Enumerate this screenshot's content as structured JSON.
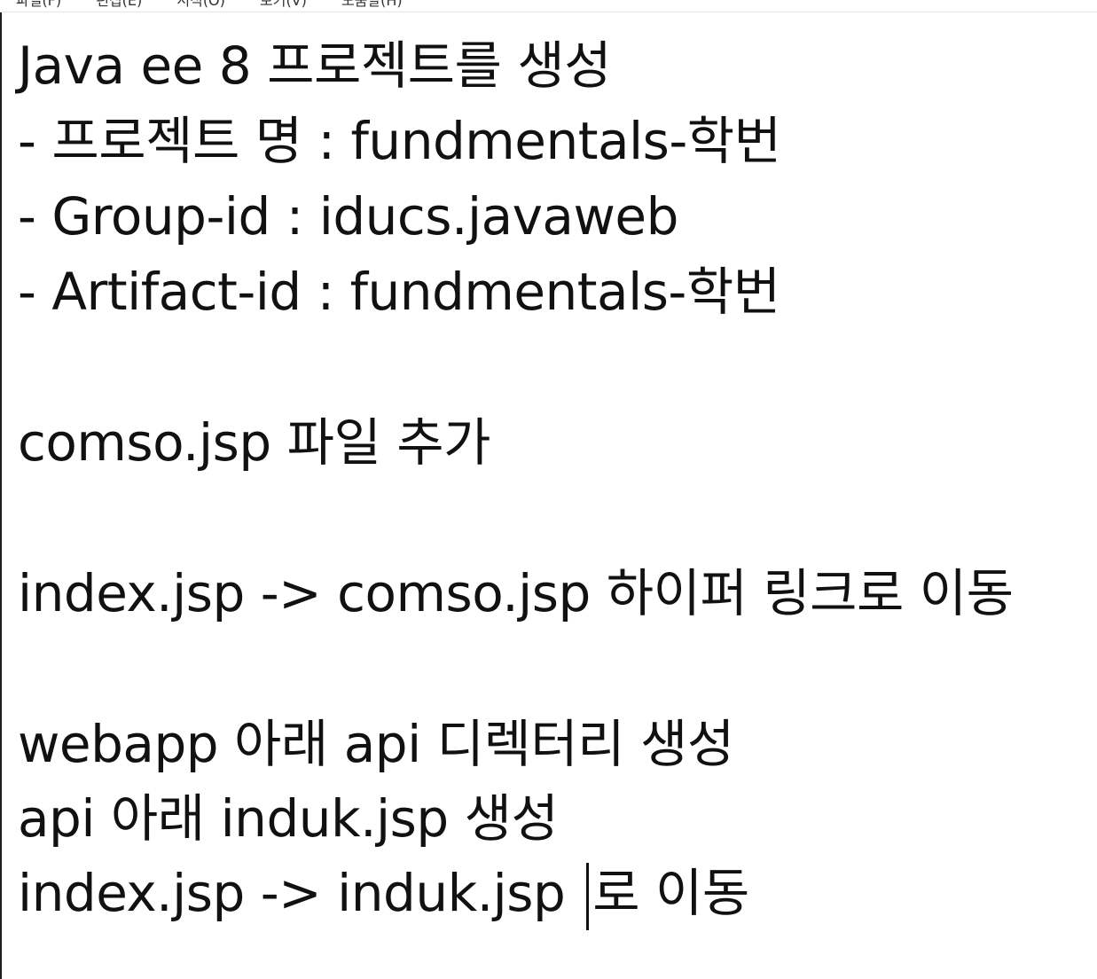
{
  "menu": {
    "items": [
      {
        "label": "파일(F)"
      },
      {
        "label": "편집(E)"
      },
      {
        "label": "서식(O)"
      },
      {
        "label": "보기(V)"
      },
      {
        "label": "도움말(H)"
      }
    ]
  },
  "document": {
    "lines": [
      "Java ee 8 프로젝트를 생성",
      "- 프로젝트 명 : fundmentals-학번",
      "- Group-id : iducs.javaweb",
      "- Artifact-id : fundmentals-학번",
      "",
      "comso.jsp 파일 추가",
      "",
      "index.jsp -> comso.jsp 하이퍼 링크로 이동",
      "",
      "webapp 아래 api 디렉터리 생성",
      "api 아래 induk.jsp 생성"
    ],
    "cursor_line": {
      "before": "index.jsp -> induk.jsp ",
      "after": "로 이동"
    }
  }
}
